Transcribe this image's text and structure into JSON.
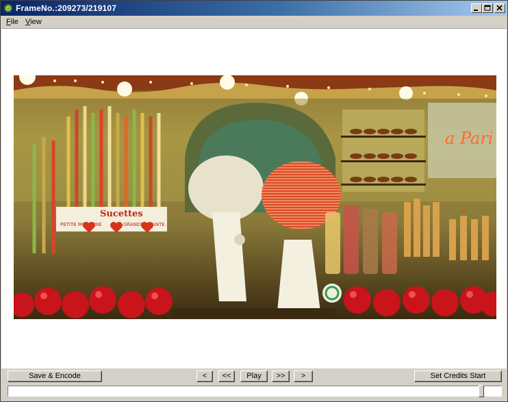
{
  "window": {
    "title": "FrameNo.:209273/219107"
  },
  "menu": {
    "file": {
      "key": "F",
      "rest": "ile"
    },
    "view": {
      "key": "V",
      "rest": "iew"
    }
  },
  "controls": {
    "save_encode": "Save & Encode",
    "prev": "<",
    "rewind": "<<",
    "play": "Play",
    "forward": ">>",
    "next": ">",
    "set_credits": "Set Credits Start"
  },
  "seek": {
    "position": 0.951
  },
  "video_frame": {
    "sign_text_1": "Sucettes",
    "sign_text_2": "PETITE MOYENNE",
    "sign_text_3": "GRANDE GEANTE",
    "neon_text": "a Pari"
  }
}
